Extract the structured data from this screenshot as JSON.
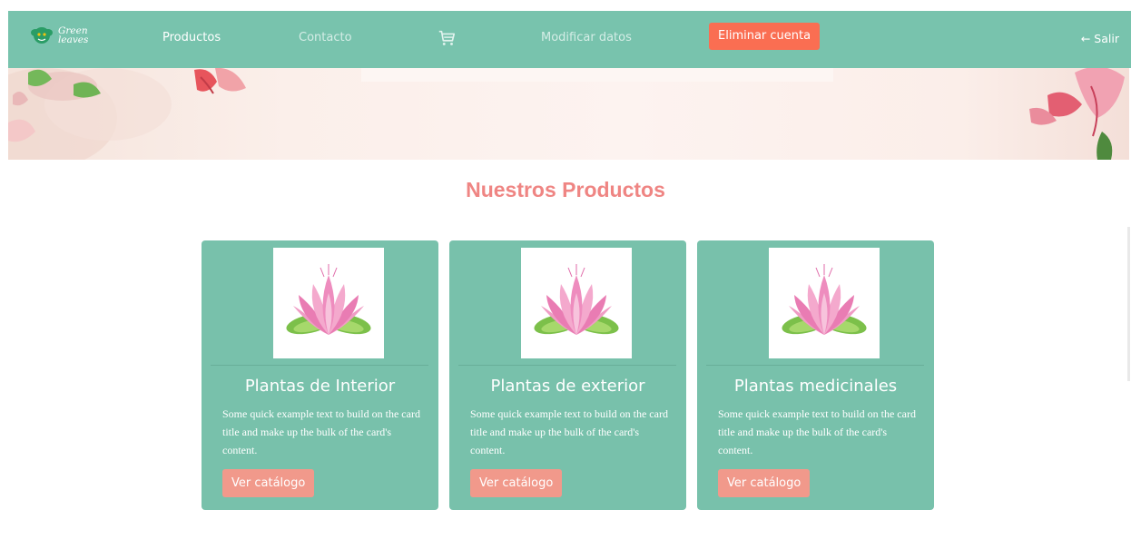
{
  "navbar": {
    "logo_line1": "Green",
    "logo_line2": "leaves",
    "productos": "Productos",
    "contacto": "Contacto",
    "cart_icon": "shopping-cart-icon",
    "modificar": "Modificar datos",
    "eliminar": "Eliminar cuenta",
    "salir": "← Salir"
  },
  "main": {
    "title": "Nuestros Productos"
  },
  "cards": [
    {
      "title": "Plantas de Interior",
      "text": "Some quick example text to build on the card title and make up the bulk of the card's content.",
      "button": "Ver catálogo"
    },
    {
      "title": "Plantas de exterior",
      "text": "Some quick example text to build on the card title and make up the bulk of the card's content.",
      "button": "Ver catálogo"
    },
    {
      "title": "Plantas medicinales",
      "text": "Some quick example text to build on the card title and make up the bulk of the card's content.",
      "button": "Ver catálogo"
    }
  ],
  "colors": {
    "navbar": "#78c3ad",
    "accent_button": "#fa6e52",
    "card": "#78c1ab",
    "card_button": "#f1998b",
    "title": "#ef8583"
  }
}
